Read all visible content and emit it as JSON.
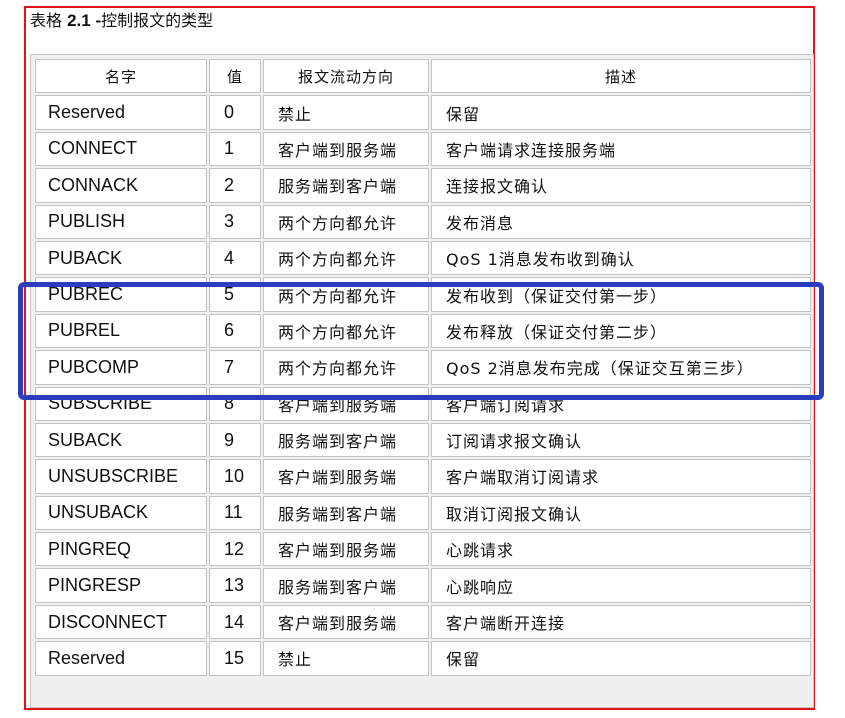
{
  "caption": {
    "prefix": "表格 ",
    "number": "2.1 -",
    "title": "控制报文的类型"
  },
  "table": {
    "headers": [
      "名字",
      "值",
      "报文流动方向",
      "描述"
    ],
    "rows": [
      [
        "Reserved",
        "0",
        "禁止",
        "保留"
      ],
      [
        "CONNECT",
        "1",
        "客户端到服务端",
        "客户端请求连接服务端"
      ],
      [
        "CONNACK",
        "2",
        "服务端到客户端",
        "连接报文确认"
      ],
      [
        "PUBLISH",
        "3",
        "两个方向都允许",
        "发布消息"
      ],
      [
        "PUBACK",
        "4",
        "两个方向都允许",
        "QoS 1消息发布收到确认"
      ],
      [
        "PUBREC",
        "5",
        "两个方向都允许",
        "发布收到（保证交付第一步）"
      ],
      [
        "PUBREL",
        "6",
        "两个方向都允许",
        "发布释放（保证交付第二步）"
      ],
      [
        "PUBCOMP",
        "7",
        "两个方向都允许",
        "QoS 2消息发布完成（保证交互第三步）"
      ],
      [
        "SUBSCRIBE",
        "8",
        "客户端到服务端",
        "客户端订阅请求"
      ],
      [
        "SUBACK",
        "9",
        "服务端到客户端",
        "订阅请求报文确认"
      ],
      [
        "UNSUBSCRIBE",
        "10",
        "客户端到服务端",
        "客户端取消订阅请求"
      ],
      [
        "UNSUBACK",
        "11",
        "服务端到客户端",
        "取消订阅报文确认"
      ],
      [
        "PINGREQ",
        "12",
        "客户端到服务端",
        "心跳请求"
      ],
      [
        "PINGRESP",
        "13",
        "服务端到客户端",
        "心跳响应"
      ],
      [
        "DISCONNECT",
        "14",
        "客户端到服务端",
        "客户端断开连接"
      ],
      [
        "Reserved",
        "15",
        "禁止",
        "保留"
      ]
    ]
  },
  "colors": {
    "outer_frame": "#e0121a",
    "highlight_box": "#2b3dbf",
    "table_bg": "#f0f0f0",
    "cell_border": "#c3c3c3"
  }
}
